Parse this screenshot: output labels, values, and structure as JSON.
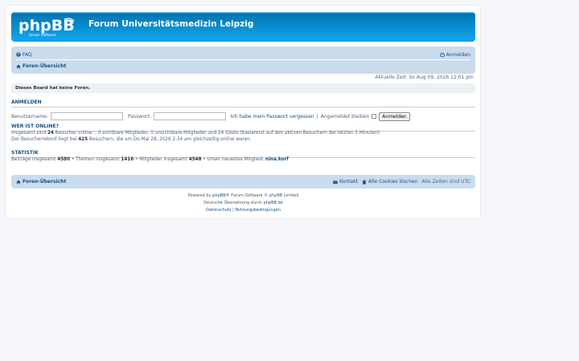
{
  "header": {
    "logo_text": "phpBB",
    "logo_subtext": "forum software",
    "site_title": "Forum Universitätsmedizin Leipzig"
  },
  "nav": {
    "faq": "FAQ",
    "login": "Anmelden",
    "board_index": "Foren-Übersicht"
  },
  "datetime": "Aktuelle Zeit: So Aug 09, 2026 12:01 pm",
  "notice": "Dieses Board hat keine Foren.",
  "login_section": {
    "heading": "ANMELDEN",
    "username_label": "Benutzername:",
    "username_value": "",
    "password_label": "Passwort:",
    "password_value": "",
    "forgot_password": "Ich habe mein Passwort vergessen",
    "separator": "|",
    "remember_label": "Angemeldet bleiben",
    "submit": "Anmelden"
  },
  "online": {
    "heading": "WER IST ONLINE?",
    "line1_pre": "Insgesamt sind ",
    "line1_count": "24",
    "line1_post": " Besucher online :: 0 sichtbare Mitglieder, 0 unsichtbare Mitglieder und 24 Gäste (basierend auf den aktiven Besuchern der letzten 5 Minuten)",
    "line2_pre": "Der Besucherrekord liegt bei ",
    "line2_count": "425",
    "line2_post": " Besuchern, die am Do Mai 28, 2026 2:34 am gleichzeitig online waren."
  },
  "stats": {
    "heading": "STATISTIK",
    "posts_label": "Beiträge insgesamt ",
    "posts": "4580",
    "topics_label": " • Themen insgesamt ",
    "topics": "1416",
    "members_label": " • Mitglieder insgesamt ",
    "members": "4548",
    "newest_label": " • Unser neuestes Mitglied: ",
    "newest": "nina.korf"
  },
  "footer_nav": {
    "board_index": "Foren-Übersicht",
    "contact": "Kontakt",
    "delete_cookies": "Alle Cookies löschen",
    "timezone": "Alle Zeiten sind UTC"
  },
  "copyright": {
    "powered_pre": "Powered by ",
    "phpbb": "phpBB",
    "powered_post": "® Forum Software © phpBB Limited",
    "translation_pre": "Deutsche Übersetzung durch ",
    "phpbb_de": "phpBB.de",
    "privacy": "Datenschutz",
    "sep": " | ",
    "terms": "Nutzungsbedingungen"
  },
  "colors": {
    "header_blue": "#12a3eb",
    "navbar": "#cadceb",
    "link": "#105289"
  }
}
